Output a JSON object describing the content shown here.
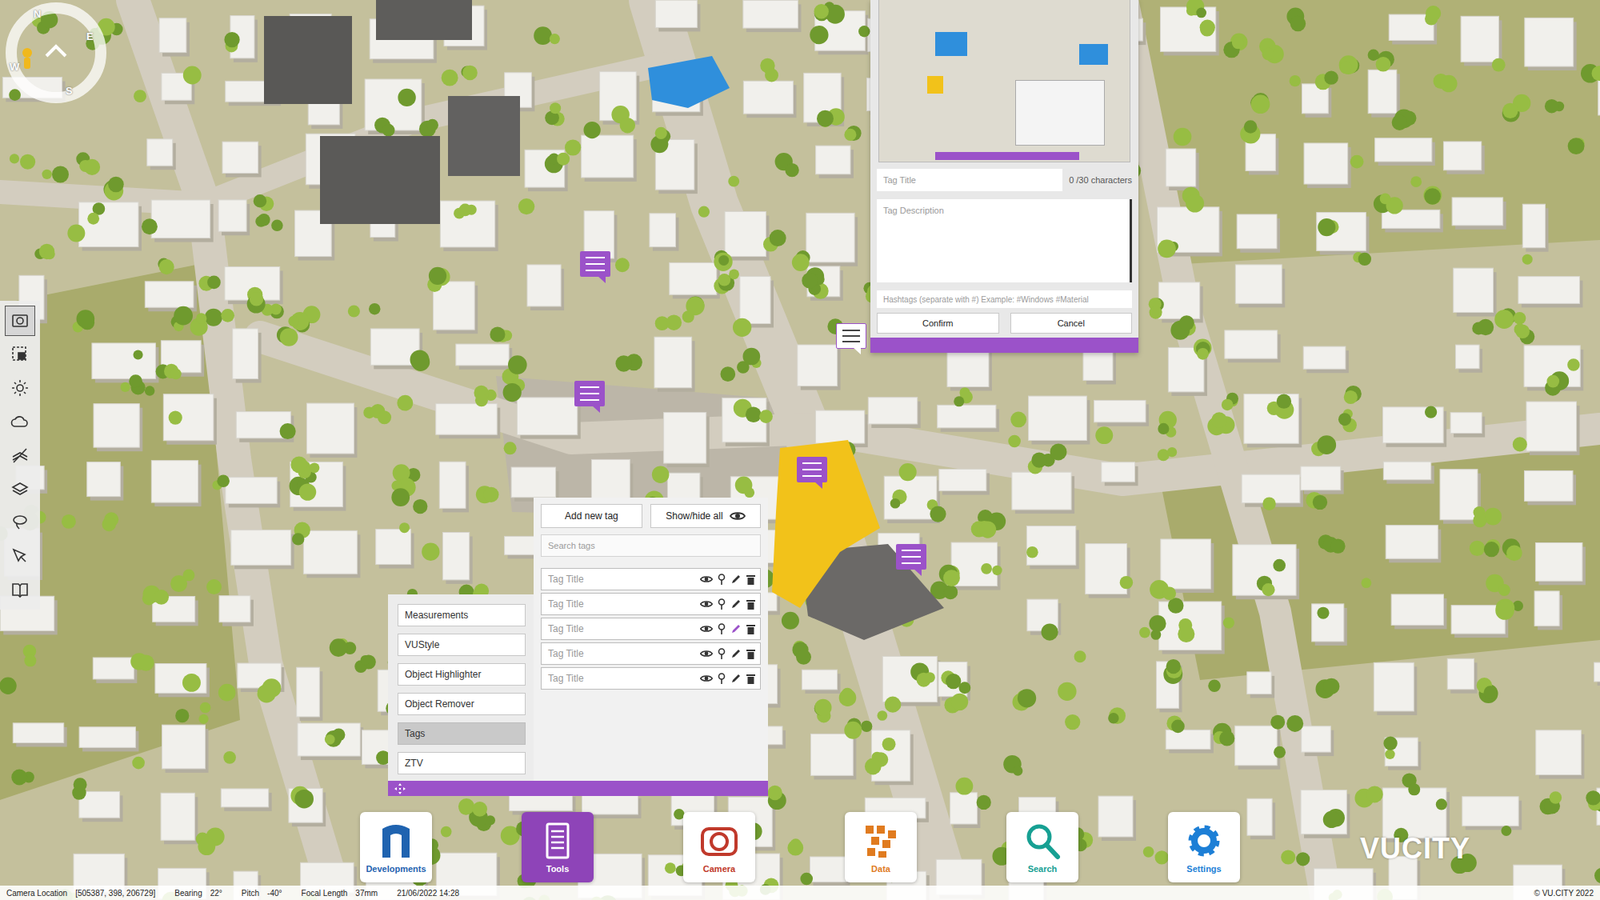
{
  "compass": {
    "letters": [
      "N",
      "E",
      "S",
      "W"
    ]
  },
  "left_toolbar": {
    "items": [
      {
        "selected": true
      },
      {
        "selected": false
      },
      {
        "selected": false
      },
      {
        "selected": false
      },
      {
        "selected": false
      },
      {
        "selected": false
      },
      {
        "selected": false
      },
      {
        "selected": false
      },
      {
        "selected": false
      }
    ]
  },
  "map_markers": [
    {
      "editing": false
    },
    {
      "editing": false
    },
    {
      "editing": true
    },
    {
      "editing": false
    },
    {
      "editing": false
    }
  ],
  "tag_editor": {
    "title_placeholder": "Tag Title",
    "counter": "0 /30 characters",
    "description_placeholder": "Tag Description",
    "hashtags_placeholder": "Hashtags (separate with #) Example: #Windows #Material",
    "buttons": [
      "Confirm",
      "Cancel"
    ]
  },
  "tools_menu": {
    "items": [
      {
        "label": "Measurements",
        "selected": false
      },
      {
        "label": "VUStyle",
        "selected": false
      },
      {
        "label": "Object Highlighter",
        "selected": false
      },
      {
        "label": "Object Remover",
        "selected": false
      },
      {
        "label": "Tags",
        "selected": true
      },
      {
        "label": "ZTV",
        "selected": false
      }
    ]
  },
  "tags_panel": {
    "add_button": "Add new tag",
    "show_hide_button": "Show/hide all",
    "search_placeholder": "Search tags",
    "rows": [
      {
        "title": "Tag Title",
        "visible": true,
        "editing": false
      },
      {
        "title": "Tag Title",
        "visible": true,
        "editing": false
      },
      {
        "title": "Tag Title",
        "visible": true,
        "editing": true
      },
      {
        "title": "Tag Title",
        "visible": true,
        "editing": false
      },
      {
        "title": "Tag Title",
        "visible": true,
        "editing": false
      }
    ]
  },
  "dock": {
    "items": [
      {
        "label": "Developments",
        "selected": false,
        "color": "#1f63b0"
      },
      {
        "label": "Tools",
        "selected": true,
        "color": "#8e44b8"
      },
      {
        "label": "Camera",
        "selected": false,
        "color": "#c0392b"
      },
      {
        "label": "Data",
        "selected": false,
        "color": "#e07b1f"
      },
      {
        "label": "Search",
        "selected": false,
        "color": "#17a093"
      },
      {
        "label": "Settings",
        "selected": false,
        "color": "#1d7fd6"
      }
    ]
  },
  "logo": "VUCITY",
  "status_bar": {
    "fields": [
      {
        "label": "Camera Location",
        "value": "[505387, 398, 206729]"
      },
      {
        "label": "Bearing",
        "value": "22°"
      },
      {
        "label": "Pitch",
        "value": "-40°"
      },
      {
        "label": "Focal Length",
        "value": "37mm"
      }
    ],
    "datetime": "21/06/2022 14:28",
    "copyright": "© VU.CITY 2022"
  }
}
